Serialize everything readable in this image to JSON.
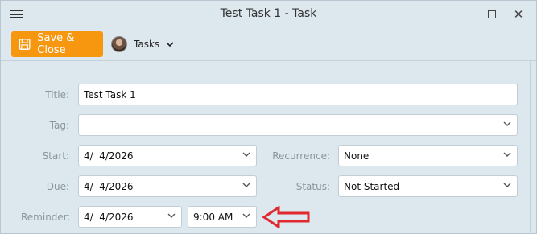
{
  "window": {
    "title": "Test Task 1 - Task",
    "controls": {
      "minimize": "minimize",
      "maximize": "maximize",
      "close": "✕"
    }
  },
  "toolbar": {
    "save_close_label": "Save & Close",
    "tasks_label": "Tasks"
  },
  "form": {
    "title_label": "Title:",
    "title_value": "Test Task 1",
    "tag_label": "Tag:",
    "tag_value": "",
    "start_label": "Start:",
    "start_value": "4/  4/2026",
    "recurrence_label": "Recurrence:",
    "recurrence_value": "None",
    "due_label": "Due:",
    "due_value": "4/  4/2026",
    "status_label": "Status:",
    "status_value": "Not Started",
    "reminder_label": "Reminder:",
    "reminder_date_value": "4/  4/2026",
    "reminder_time_value": "9:00 AM"
  },
  "colors": {
    "window_bg": "#dde7ee",
    "accent": "#f7960f",
    "label_text": "#8a949c",
    "annotation_arrow": "#e0282e"
  },
  "icons": {
    "menu": "hamburger-icon",
    "save": "save-icon",
    "dropdown": "chevron-down-icon",
    "annotation": "red-arrow-icon"
  }
}
